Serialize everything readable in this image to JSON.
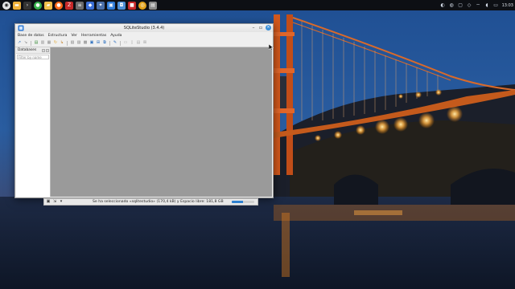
{
  "window": {
    "title": "SQLiteStudio (3.4.4)"
  },
  "menubar": {
    "items": [
      {
        "label": "Base de datos"
      },
      {
        "label": "Estructura"
      },
      {
        "label": "Ver"
      },
      {
        "label": "Herramientas"
      },
      {
        "label": "Ayuda"
      }
    ]
  },
  "databases_panel": {
    "title": "Databases",
    "filter_placeholder": "Filter by name"
  },
  "statusbar": {
    "message": "Se ha seleccionado «sqlitestudio» (170,4 kB) y Espacio libre: 181,8 GB",
    "progress": 0.5
  },
  "panel": {
    "clock": "13:03"
  },
  "colors": {
    "accent": "#3c8fd8",
    "mdi_background": "#9a9a9a",
    "panel_background": "#0d0f14"
  },
  "icons": [
    "app-menu-icon",
    "files-icon",
    "terminal-icon",
    "settings-icon",
    "folder-icon",
    "firefox-icon",
    "filezilla-icon",
    "text-editor-icon",
    "software-center-icon",
    "app-icon",
    "app-icon",
    "sqlitestudio-icon",
    "app-icon",
    "chrome-icon",
    "app-icon"
  ]
}
